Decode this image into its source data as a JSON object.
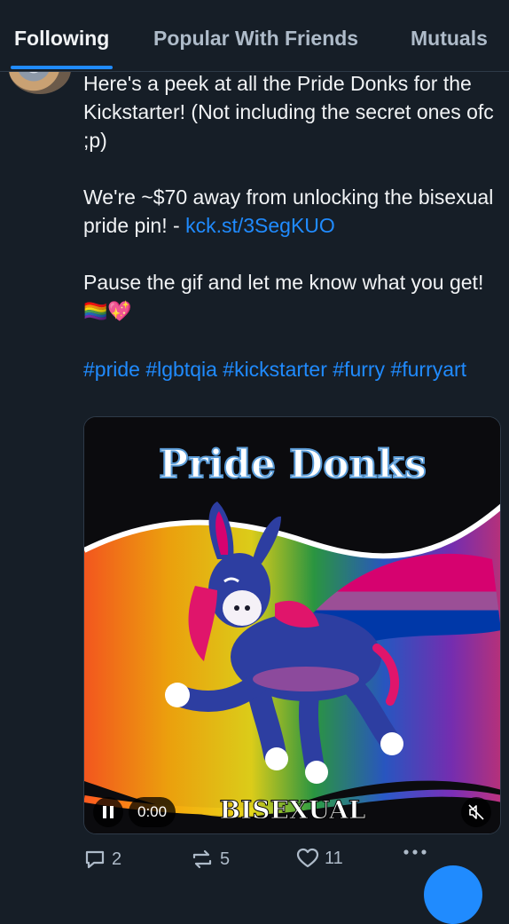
{
  "tabs": [
    {
      "label": "Following",
      "active": true
    },
    {
      "label": "Popular With Friends",
      "active": false
    },
    {
      "label": "Mutuals",
      "active": false
    }
  ],
  "post": {
    "line1": "Here's a peek at all the Pride Donks for the Kickstarter! (Not including the secret ones ofc ;p)",
    "line2_text": "We're ~$70 away from unlocking the bisexual pride pin! - ",
    "line2_link": "kck.st/3SegKUO",
    "line3_text": "Pause the gif and let me know what you get! ",
    "line3_emoji": "🏳️‍🌈💖",
    "hashtags": "#pride #lgbtqia #kickstarter #furry #furryart"
  },
  "media": {
    "title": "Pride Donks",
    "caption": "BISEXUAL",
    "time": "0:00",
    "play_state": "paused"
  },
  "actions": {
    "replies": "2",
    "reposts": "5",
    "likes": "11"
  },
  "colors": {
    "accent": "#208bfe",
    "background": "#161e27",
    "muted": "#aebbc9"
  }
}
